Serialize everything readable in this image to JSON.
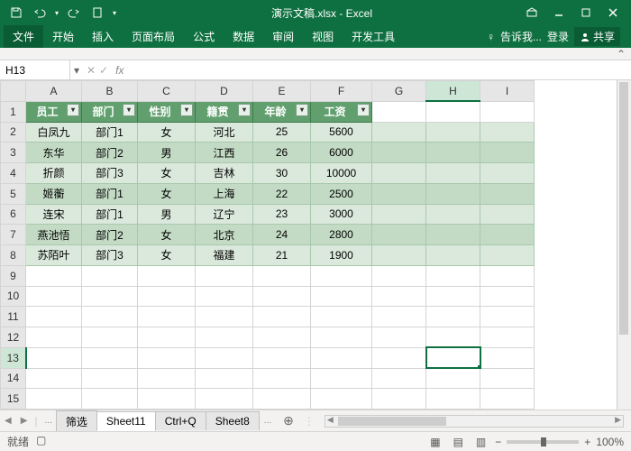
{
  "title": "演示文稿.xlsx - Excel",
  "tabs": {
    "file": "文件",
    "list": [
      "开始",
      "插入",
      "页面布局",
      "公式",
      "数据",
      "审阅",
      "视图",
      "开发工具"
    ],
    "tell": "告诉我...",
    "login": "登录",
    "share": "共享"
  },
  "namebox": "H13",
  "cols": [
    "A",
    "B",
    "C",
    "D",
    "E",
    "F",
    "G",
    "H",
    "I"
  ],
  "selCol": "H",
  "selRow": 13,
  "rowCount": 15,
  "headers": [
    "员工",
    "部门",
    "性别",
    "籍贯",
    "年龄",
    "工资"
  ],
  "data": [
    [
      "白凤九",
      "部门1",
      "女",
      "河北",
      "25",
      "5600"
    ],
    [
      "东华",
      "部门2",
      "男",
      "江西",
      "26",
      "6000"
    ],
    [
      "折颜",
      "部门3",
      "女",
      "吉林",
      "30",
      "10000"
    ],
    [
      "姬蘅",
      "部门1",
      "女",
      "上海",
      "22",
      "2500"
    ],
    [
      "连宋",
      "部门1",
      "男",
      "辽宁",
      "23",
      "3000"
    ],
    [
      "燕池悟",
      "部门2",
      "女",
      "北京",
      "24",
      "2800"
    ],
    [
      "苏陌叶",
      "部门3",
      "女",
      "福建",
      "21",
      "1900"
    ]
  ],
  "sheets": [
    "筛选",
    "Sheet11",
    "Ctrl+Q",
    "Sheet8"
  ],
  "activeSheet": "Sheet11",
  "sheetMore": "...",
  "status": {
    "ready": "就绪",
    "rec": "",
    "zoom": "100%"
  },
  "zoomMinus": "−",
  "zoomPlus": "+"
}
